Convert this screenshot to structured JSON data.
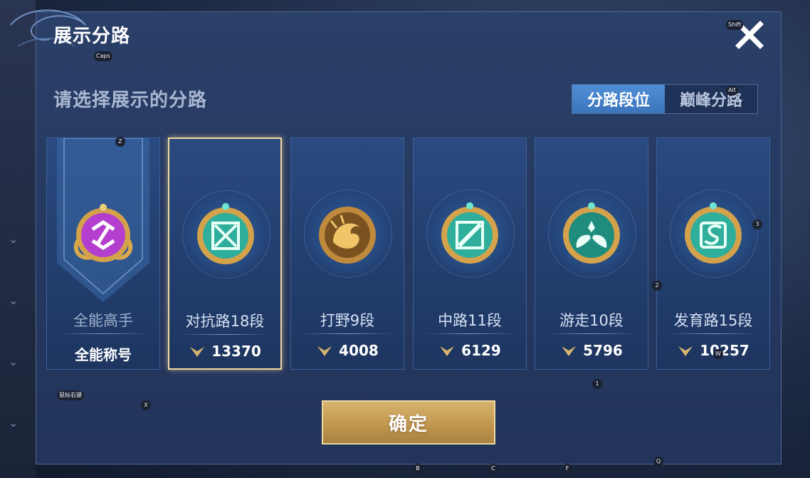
{
  "header": {
    "title": "展示分路",
    "subtitle": "请选择展示的分路"
  },
  "toggle": {
    "options": [
      "分路段位",
      "巅峰分路"
    ],
    "active_index": 0
  },
  "cards": [
    {
      "name": "全能高手",
      "bottom_label": "全能称号",
      "badge_icon": "all-round-emblem-icon",
      "badge_color": "#b43fcf"
    },
    {
      "name": "对抗路18段",
      "score": "13370",
      "badge_icon": "clash-lane-emblem-icon",
      "badge_color": "#3fc8b0",
      "selected": true
    },
    {
      "name": "打野9段",
      "score": "4008",
      "badge_icon": "jungle-dragon-emblem-icon",
      "badge_color": "#c89240"
    },
    {
      "name": "中路11段",
      "score": "6129",
      "badge_icon": "mid-lane-emblem-icon",
      "badge_color": "#3fc8b0"
    },
    {
      "name": "游走10段",
      "score": "5796",
      "badge_icon": "roam-wings-emblem-icon",
      "badge_color": "#3fc8b0"
    },
    {
      "name": "发育路15段",
      "score": "10257",
      "badge_icon": "farm-lane-emblem-icon",
      "badge_color": "#3fc8b0"
    }
  ],
  "confirm_label": "确定",
  "key_hints": {
    "caps": "Caps",
    "shift": "Shift",
    "alt": "Alt",
    "z": "Z",
    "x": "X",
    "mouse_right": "鼠标右键",
    "b": "B",
    "c": "C",
    "f": "F",
    "q": "Q",
    "one": "1",
    "two": "2",
    "three": "3",
    "w": "W"
  },
  "colors": {
    "accent": "#3b74bb",
    "gold": "#c39a52",
    "panel": "#253961"
  }
}
